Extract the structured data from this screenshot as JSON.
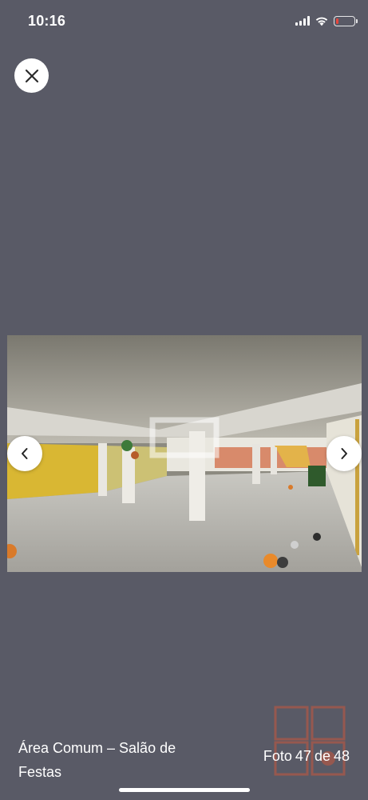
{
  "status_bar": {
    "time": "10:16",
    "battery_color": "#e8453c",
    "battery_level": 0.15,
    "icons": [
      "signal-icon",
      "wifi-icon",
      "battery-icon"
    ]
  },
  "viewer": {
    "close_icon": "close-icon",
    "prev_icon": "chevron-left-icon",
    "next_icon": "chevron-right-icon",
    "background_color": "#595a66"
  },
  "caption": {
    "title": "Área Comum – Salão de Festas"
  },
  "counter": {
    "prefix": "Foto",
    "current": "47",
    "separator": "de",
    "total": "48"
  }
}
